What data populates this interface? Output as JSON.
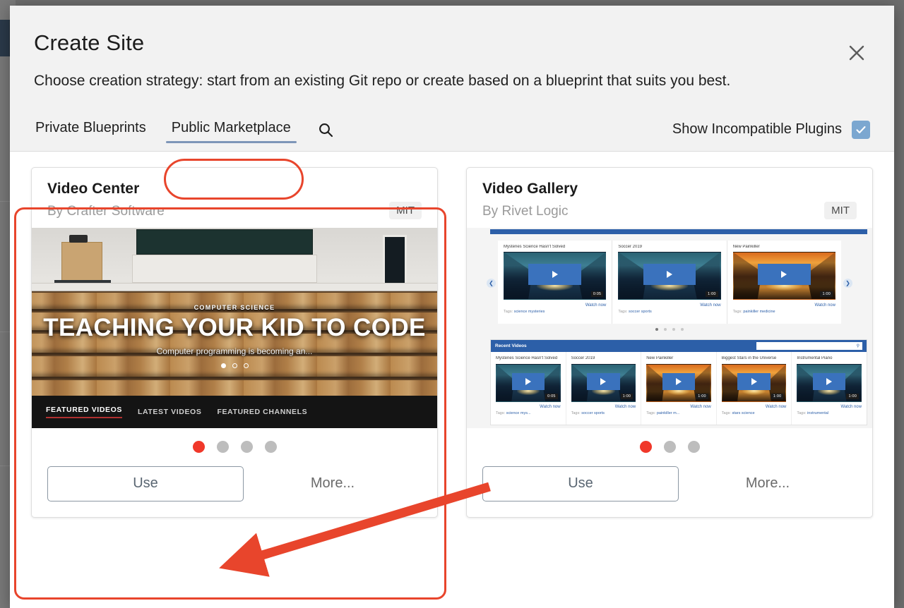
{
  "dialog": {
    "title": "Create Site",
    "description": "Choose creation strategy: start from an existing Git repo or create based on a blueprint that suits you best.",
    "close_icon": "close-icon"
  },
  "tabs": [
    {
      "label": "Private Blueprints",
      "active": false
    },
    {
      "label": "Public Marketplace",
      "active": true
    }
  ],
  "toolbar": {
    "search_icon": "search-icon",
    "incompatible_label": "Show Incompatible Plugins",
    "incompatible_checked": true
  },
  "cards": [
    {
      "title": "Video Center",
      "author": "By Crafter Software",
      "license": "MIT",
      "dots": 4,
      "active_dot": 0,
      "use_label": "Use",
      "more_label": "More...",
      "selected": true,
      "preview": {
        "kind": "video-center-hero",
        "eyebrow": "COMPUTER SCIENCE",
        "headline": "TEACHING YOUR KID TO CODE",
        "subline": "Computer programming is becoming an...",
        "hero_dots": 3,
        "hero_active_dot": 0,
        "nav": [
          "FEATURED VIDEOS",
          "LATEST VIDEOS",
          "FEATURED CHANNELS"
        ],
        "nav_active": "FEATURED VIDEOS"
      }
    },
    {
      "title": "Video Gallery",
      "author": "By Rivet Logic",
      "license": "MIT",
      "dots": 3,
      "active_dot": 0,
      "use_label": "Use",
      "more_label": "More...",
      "selected": false,
      "preview": {
        "kind": "video-gallery",
        "prev_arrow": "chevron-left-icon",
        "next_arrow": "chevron-right-icon",
        "carousel_dots": 4,
        "carousel_active_dot": 0,
        "carousel": [
          {
            "title": "Mysteries Science Hasn't Solved",
            "duration": "0:05",
            "watch": "Watch now",
            "tags_label": "Tags:",
            "tags": "science  mysteries",
            "art": "night"
          },
          {
            "title": "Soccer 2019",
            "duration": "1:00",
            "watch": "Watch now",
            "tags_label": "Tags:",
            "tags": "soccer  sports",
            "art": "night"
          },
          {
            "title": "New Painkiller",
            "duration": "1:00",
            "watch": "Watch now",
            "tags_label": "Tags:",
            "tags": "painkiller  medicine",
            "art": "sunset"
          }
        ],
        "section_title": "Recent Videos",
        "section_search_icon": "search-icon",
        "grid": [
          {
            "title": "Mysteries Science Hasn't Solved",
            "duration": "0:05",
            "watch": "Watch now",
            "tags_label": "Tags:",
            "tags": "science  mys...",
            "art": "night"
          },
          {
            "title": "Soccer 2019",
            "duration": "1:00",
            "watch": "Watch now",
            "tags_label": "Tags:",
            "tags": "soccer  sports",
            "art": "night"
          },
          {
            "title": "New Painkiller",
            "duration": "1:00",
            "watch": "Watch now",
            "tags_label": "Tags:",
            "tags": "painkiller  m...",
            "art": "sunset"
          },
          {
            "title": "Biggest Stars in the Universe",
            "duration": "1:00",
            "watch": "Watch now",
            "tags_label": "Tags:",
            "tags": "stars  science",
            "art": "sunset"
          },
          {
            "title": "Instrumental Piano",
            "duration": "1:00",
            "watch": "Watch now",
            "tags_label": "Tags:",
            "tags": "instrumental",
            "art": "night"
          }
        ]
      }
    }
  ],
  "annotations": {
    "highlight_color": "#e8452c",
    "arrow_color": "#e8452c"
  },
  "colors": {
    "accent_red": "#f0382a",
    "tab_underline": "#7e96b8",
    "checkbox": "#7ba7d0",
    "dialog_bg": "#f2f2f2",
    "content_bg": "#ffffff"
  }
}
